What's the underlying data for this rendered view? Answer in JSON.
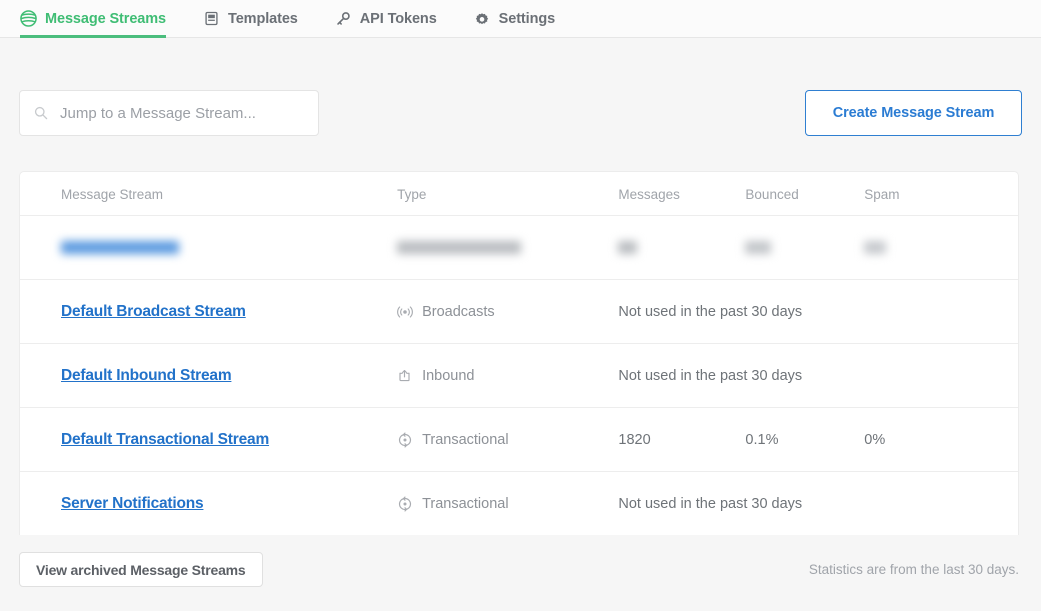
{
  "nav": {
    "items": [
      {
        "label": "Message Streams",
        "icon": "streams-icon",
        "active": true
      },
      {
        "label": "Templates",
        "icon": "templates-icon",
        "active": false
      },
      {
        "label": "API Tokens",
        "icon": "key-icon",
        "active": false
      },
      {
        "label": "Settings",
        "icon": "gear-icon",
        "active": false
      }
    ],
    "active_color": "#4bbd7d"
  },
  "toolbar": {
    "search_placeholder": "Jump to a Message Stream...",
    "search_value": "",
    "create_label": "Create Message Stream",
    "create_color": "#2b7cd3"
  },
  "table": {
    "columns": [
      "Message Stream",
      "Type",
      "Messages",
      "Bounced",
      "Spam"
    ],
    "rows": [
      {
        "name": "",
        "type": "",
        "messages": "",
        "bounced": "",
        "spam": "",
        "redacted": true,
        "type_icon": ""
      },
      {
        "name": "Default Broadcast Stream",
        "type": "Broadcasts",
        "type_icon": "broadcast-icon",
        "messages": "Not used in the past 30 days",
        "bounced": "",
        "spam": "",
        "redacted": false,
        "unused": true
      },
      {
        "name": "Default Inbound Stream",
        "type": "Inbound",
        "type_icon": "inbound-icon",
        "messages": "Not used in the past 30 days",
        "bounced": "",
        "spam": "",
        "redacted": false,
        "unused": true
      },
      {
        "name": "Default Transactional Stream",
        "type": "Transactional",
        "type_icon": "transactional-icon",
        "messages": "1820",
        "bounced": "0.1%",
        "spam": "0%",
        "redacted": false,
        "unused": false
      },
      {
        "name": "Server Notifications",
        "type": "Transactional",
        "type_icon": "transactional-icon",
        "messages": "Not used in the past 30 days",
        "bounced": "",
        "spam": "",
        "redacted": false,
        "unused": true
      }
    ]
  },
  "footer": {
    "archive_label": "View archived Message Streams",
    "note": "Statistics are from the last 30 days."
  }
}
